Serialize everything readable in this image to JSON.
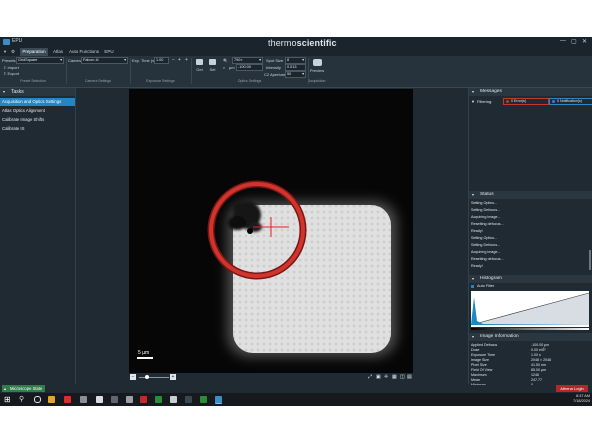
{
  "window": {
    "title": "EPU",
    "brand_thin": "thermo",
    "brand_bold": "scientific"
  },
  "tabs": [
    {
      "label": "Preparation",
      "active": true
    },
    {
      "label": "Atlas"
    },
    {
      "label": "Auto Functions"
    },
    {
      "label": "EPU"
    }
  ],
  "ribbon": {
    "presets_label": "Presets",
    "presets_value": "GridSquare",
    "import_label": "Import",
    "export_label": "Export",
    "camera_label": "Camera",
    "camera_value": "Falcon 4i",
    "exp_time_label": "Exp. Time (s)",
    "exp_time_value": "1.00",
    "get_label": "Get",
    "set_label": "Set",
    "magnification_value": "790×",
    "spot_size_label": "Spot Size",
    "spot_size_value": "8",
    "intensity_label": "Intensity",
    "intensity_value": "0.013",
    "c2_aperture_label": "C2 Aperture",
    "c2_aperture_value": "50",
    "defocus_unit": "µm",
    "defocus_value": "-100.00",
    "preview_label": "Preview",
    "sections": {
      "preset_selection": "Preset Selection",
      "camera_settings": "Camera Settings",
      "exposure_settings": "Exposure Settings",
      "optics_settings": "Optics Settings",
      "acquisition": "Acquisition"
    }
  },
  "left_pane": {
    "title": "Tasks",
    "items": [
      {
        "label": "Acquisition and Optics Settings",
        "selected": true
      },
      {
        "label": "Atlas Optics Alignment"
      },
      {
        "label": "Calibrate Image Shifts"
      },
      {
        "label": "Calibrate IS"
      }
    ]
  },
  "viewer": {
    "scale_bar_label": "5 µm"
  },
  "right_pane": {
    "messages_title": "Messages",
    "filtering_label": "Filtering:",
    "errors_label": "0 Error(s)",
    "notifications_label": "0 Notification(s)",
    "status_title": "Status",
    "status_lines": [
      "Setting Optics...",
      "Setting Defocus...",
      "Acquiring image...",
      "Resetting defocus...",
      "Ready!",
      "Setting Optics...",
      "Setting Defocus...",
      "Acquiring image...",
      "Resetting defocus...",
      "Ready!"
    ],
    "histogram_title": "Histogram",
    "auto_filter_label": "Auto Filter",
    "image_info_title": "Image Information",
    "info_rows": [
      {
        "k": "Applied Defocus",
        "v": "-100.00 µm"
      },
      {
        "k": "Dose",
        "v": "0.00 e/Å²"
      },
      {
        "k": "Exposure Time",
        "v": "1.00 s"
      },
      {
        "k": "Image Size",
        "v": "2048 × 2048"
      },
      {
        "k": "Pixel Size",
        "v": "41.50 nm"
      },
      {
        "k": "Field Of View",
        "v": "85.00 µm"
      },
      {
        "k": "Maximum",
        "v": "1246"
      },
      {
        "k": "Mean",
        "v": "247.77"
      },
      {
        "k": "Minimum",
        "v": "0"
      }
    ]
  },
  "bottom": {
    "microscope_state_label": "Microscope State",
    "athena_login_label": "Athena Login"
  },
  "taskbar": {
    "time": "8:37 AM",
    "date": "7/18/2024"
  },
  "colors": {
    "accent": "#1f86c8",
    "circle": "#d0342c",
    "crosshair": "#e2202a",
    "state_green": "#2e7d4b",
    "login_red": "#b8242b"
  }
}
